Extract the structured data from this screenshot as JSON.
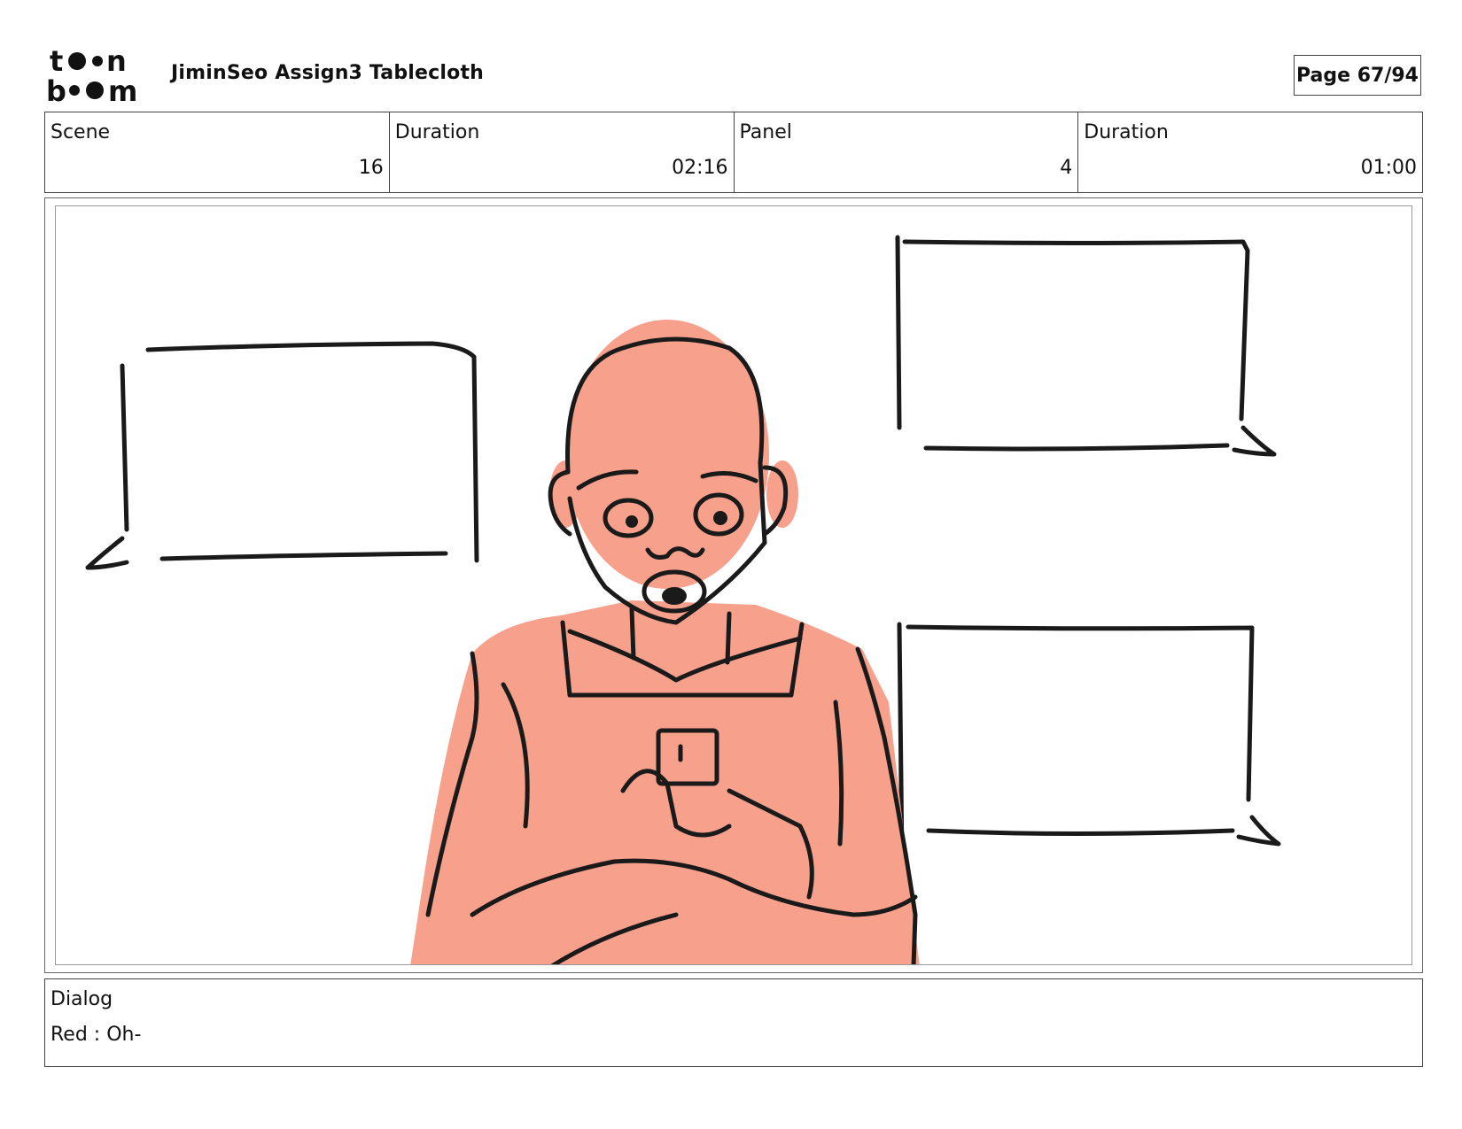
{
  "header": {
    "logo_text": "toon boom",
    "title": "JiminSeo Assign3 Tablecloth",
    "page": "Page 67/94"
  },
  "info": [
    {
      "label": "Scene",
      "value": "16"
    },
    {
      "label": "Duration",
      "value": "02:16"
    },
    {
      "label": "Panel",
      "value": "4"
    },
    {
      "label": "Duration",
      "value": "01:00"
    }
  ],
  "panel": {
    "icon": "storyboard-sketch-character-with-phone",
    "fill_color": "#f7a08c",
    "line_color": "#1a1a1a"
  },
  "dialog": {
    "label": "Dialog",
    "text": "Red : Oh-"
  }
}
